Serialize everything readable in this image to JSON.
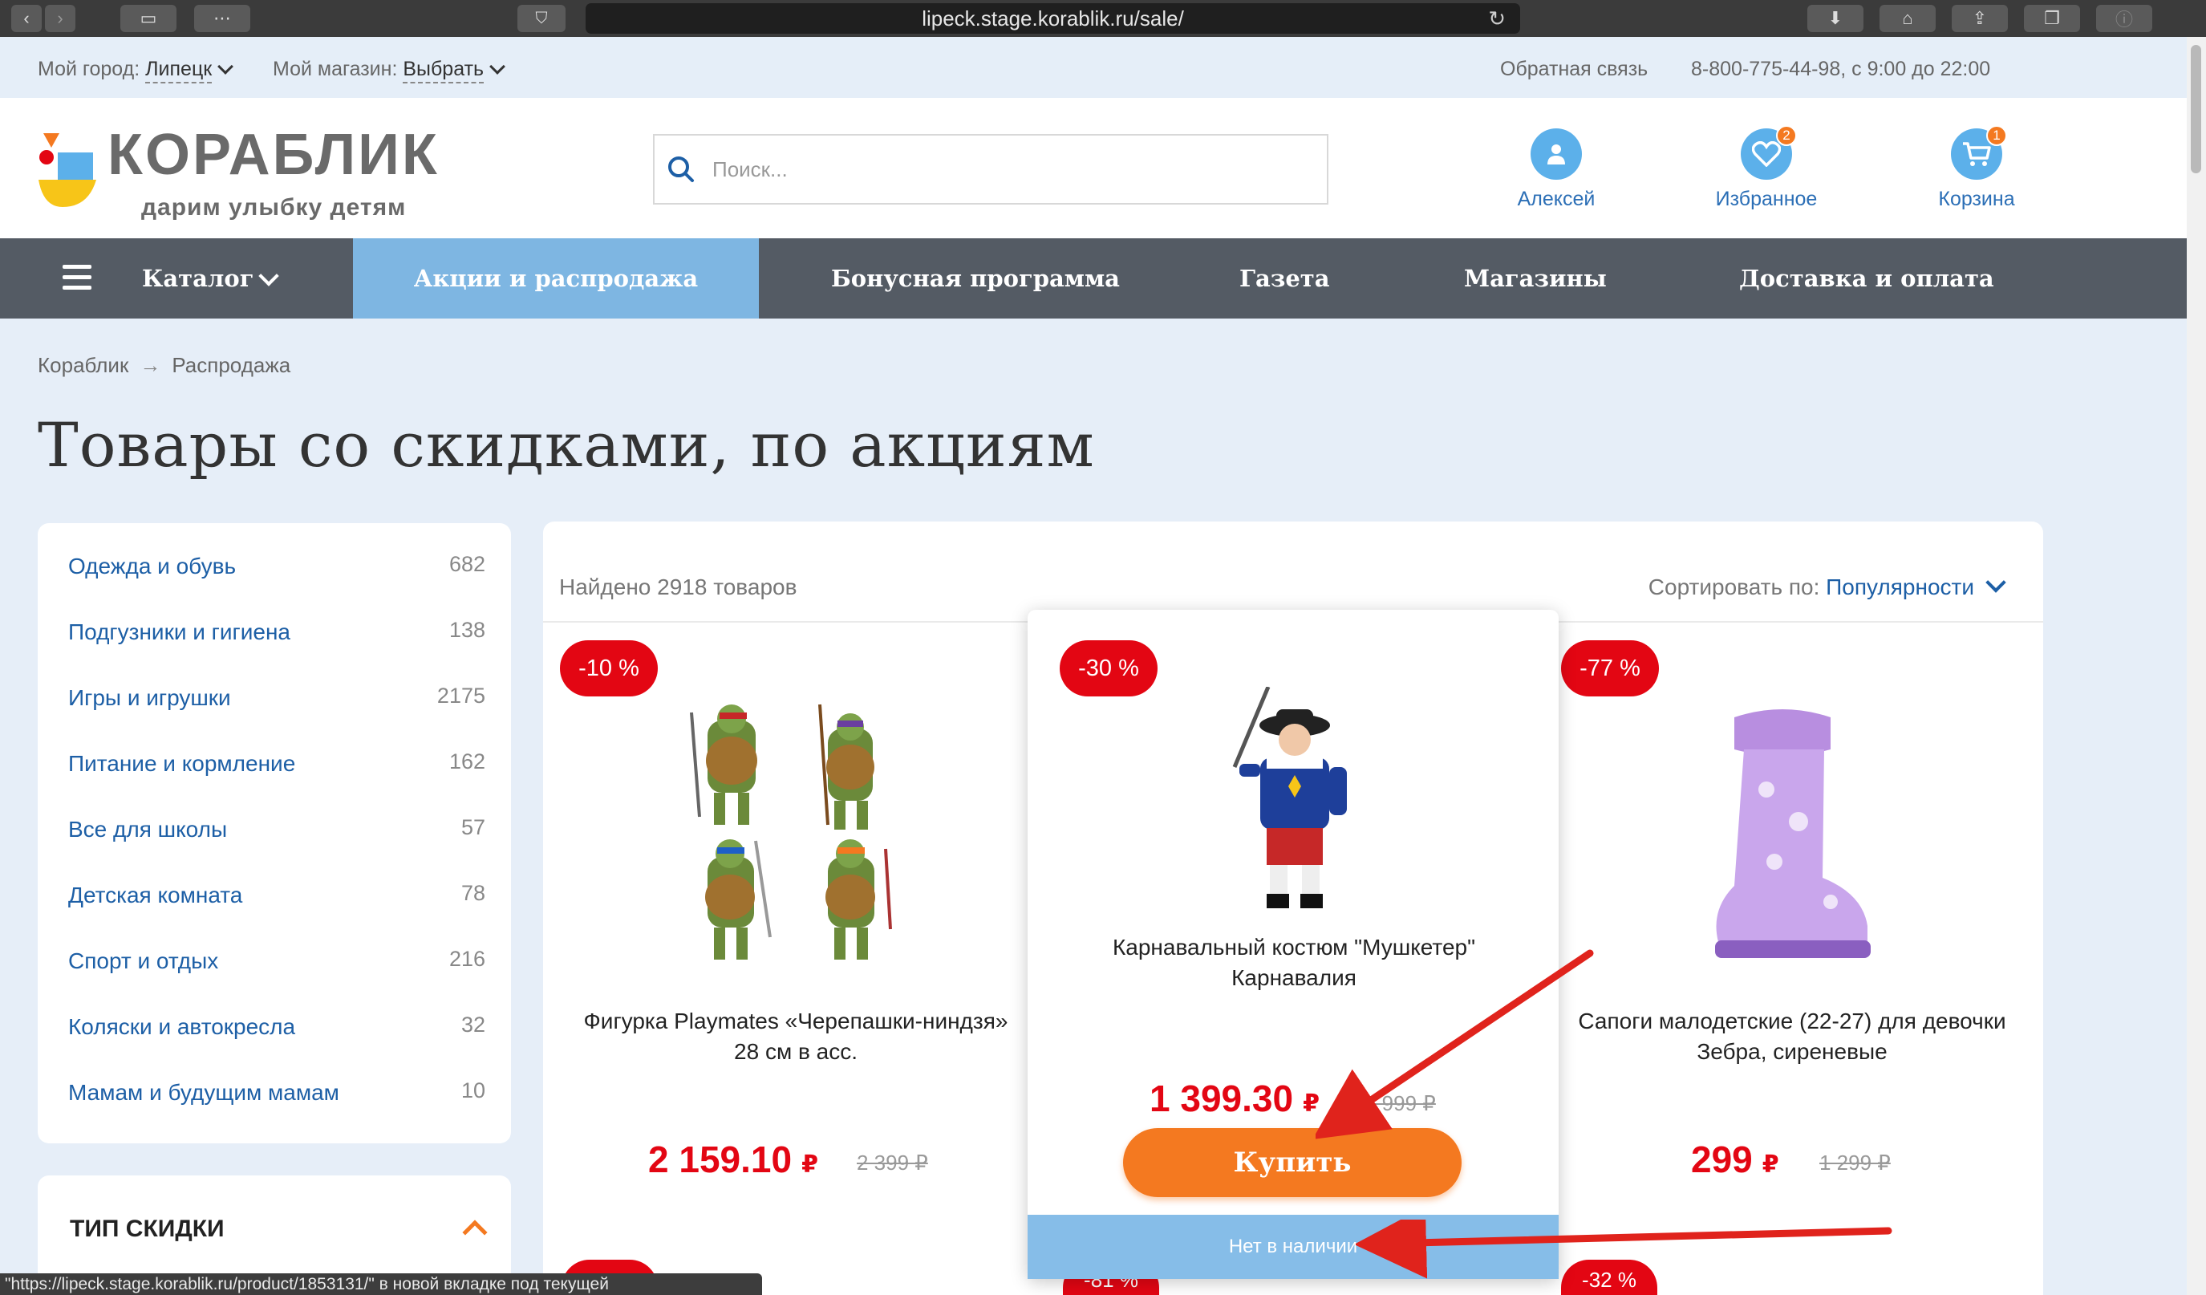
{
  "browser": {
    "url": "lipeck.stage.korablik.ru/sale/",
    "status_link": "\"https://lipeck.stage.korablik.ru/product/1853131/\" в новой вкладке под текущей"
  },
  "topbar": {
    "city_label": "Мой город:",
    "city_value": "Липецк",
    "store_label": "Мой магазин:",
    "store_value": "Выбрать",
    "feedback": "Обратная связь",
    "phone": "8-800-775-44-98, с 9:00 до 22:00"
  },
  "header": {
    "logo_word": "КОРАБЛИК",
    "logo_slogan": "дарим улыбку детям",
    "search_placeholder": "Поиск...",
    "user_label": "Алексей",
    "fav_label": "Избранное",
    "fav_count": "2",
    "cart_label": "Корзина",
    "cart_count": "1"
  },
  "nav": {
    "catalog": "Каталог",
    "sale": "Акции и распродажа",
    "bonus": "Бонусная программа",
    "newspaper": "Газета",
    "stores": "Магазины",
    "delivery": "Доставка и оплата"
  },
  "breadcrumb": {
    "home": "Кораблик",
    "arrow": "→",
    "current": "Распродажа"
  },
  "page_title": "Товары со скидками, по акциям",
  "categories": [
    {
      "label": "Одежда и обувь",
      "count": "682"
    },
    {
      "label": "Подгузники и гигиена",
      "count": "138"
    },
    {
      "label": "Игры и игрушки",
      "count": "2175"
    },
    {
      "label": "Питание и кормление",
      "count": "162"
    },
    {
      "label": "Все для школы",
      "count": "57"
    },
    {
      "label": "Детская комната",
      "count": "78"
    },
    {
      "label": "Спорт и отдых",
      "count": "216"
    },
    {
      "label": "Коляски и автокресла",
      "count": "32"
    },
    {
      "label": "Мамам и будущим мамам",
      "count": "10"
    }
  ],
  "filter": {
    "discount_type": "ТИП СКИДКИ"
  },
  "listing": {
    "found": "Найдено 2918 товаров",
    "sort_label": "Сортировать по:",
    "sort_value": "Популярности"
  },
  "products": [
    {
      "discount": "-10 %",
      "name": "Фигурка Playmates «Черепашки-ниндзя» 28 см в асс.",
      "price": "2 159.10",
      "currency": "₽",
      "old_price": "2 399 ₽"
    },
    {
      "discount": "-30 %",
      "name": "Карнавальный костюм \"Мушкетер\" Карнавалия",
      "price": "1 399.30",
      "currency": "₽",
      "old_price": "1 999 ₽",
      "buy_label": "Купить",
      "stock_status": "Нет в наличии"
    },
    {
      "discount": "-77 %",
      "name": "Сапоги малодетские (22-27) для девочки Зебра, сиреневые",
      "price": "299",
      "currency": "₽",
      "old_price": "1 299 ₽"
    }
  ],
  "next_row_discounts": [
    "-81 %",
    "-32 %"
  ],
  "colors": {
    "accent_orange": "#f47920",
    "sale_red": "#e30613",
    "nav_bg": "#545b64",
    "nav_active": "#7eb6e2",
    "link_blue": "#1d5fa6"
  }
}
